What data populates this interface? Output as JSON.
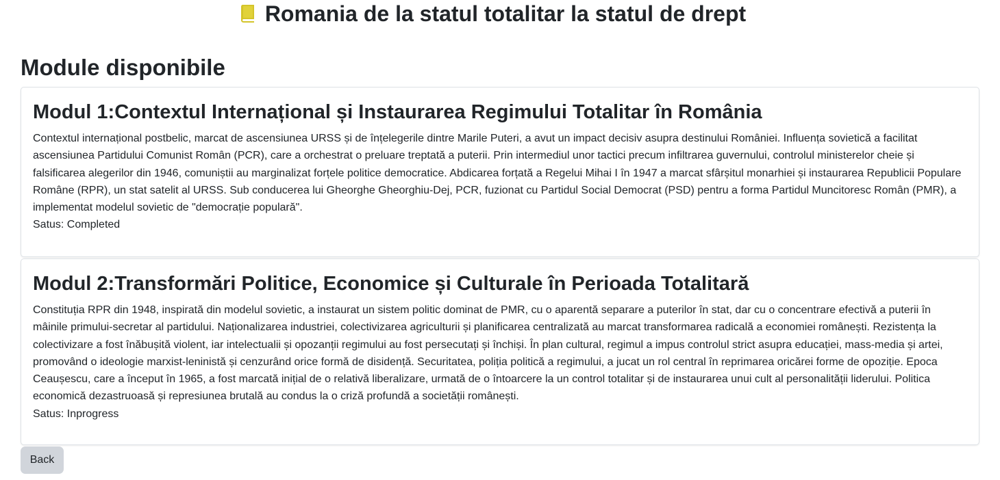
{
  "header": {
    "title": "Romania de la statul totalitar la statul de drept",
    "icon": "book-icon",
    "icon_color": "#d4c42a"
  },
  "section": {
    "title": "Module disponibile"
  },
  "modules": [
    {
      "title": "Modul 1:Contextul Internațional și Instaurarea Regimului Totalitar în România",
      "description": "Contextul internațional postbelic, marcat de ascensiunea URSS și de înțelegerile dintre Marile Puteri, a avut un impact decisiv asupra destinului României. Influența sovietică a facilitat ascensiunea Partidului Comunist Român (PCR), care a orchestrat o preluare treptată a puterii. Prin intermediul unor tactici precum infiltrarea guvernului, controlul ministerelor cheie și falsificarea alegerilor din 1946, comuniștii au marginalizat forțele politice democratice. Abdicarea forțată a Regelui Mihai I în 1947 a marcat sfârșitul monarhiei și instaurarea Republicii Populare Române (RPR), un stat satelit al URSS. Sub conducerea lui Gheorghe Gheorghiu-Dej, PCR, fuzionat cu Partidul Social Democrat (PSD) pentru a forma Partidul Muncitoresc Român (PMR), a implementat modelul sovietic de \"democrație populară\".",
      "status": "Satus: Completed"
    },
    {
      "title": "Modul 2:Transformări Politice, Economice și Culturale în Perioada Totalitară",
      "description": "Constituția RPR din 1948, inspirată din modelul sovietic, a instaurat un sistem politic dominat de PMR, cu o aparentă separare a puterilor în stat, dar cu o concentrare efectivă a puterii în mâinile primului-secretar al partidului. Naționalizarea industriei, colectivizarea agriculturii și planificarea centralizată au marcat transformarea radicală a economiei românești. Rezistența la colectivizare a fost înăbușită violent, iar intelectualii și opozanții regimului au fost persecutați și închiși. În plan cultural, regimul a impus controlul strict asupra educației, mass-media și artei, promovând o ideologie marxist-leninistă și cenzurând orice formă de disidență. Securitatea, poliția politică a regimului, a jucat un rol central în reprimarea oricărei forme de opoziție. Epoca Ceaușescu, care a început în 1965, a fost marcată inițial de o relativă liberalizare, urmată de o întoarcere la un control totalitar și de instaurarea unui cult al personalității liderului. Politica economică dezastruoasă și represiunea brutală au condus la o criză profundă a societății românești.",
      "status": "Satus: Inprogress"
    }
  ],
  "actions": {
    "back_label": "Back"
  }
}
